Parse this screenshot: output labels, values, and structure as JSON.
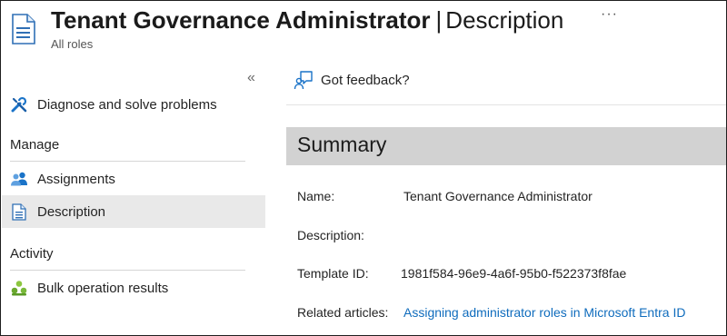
{
  "header": {
    "title_main": "Tenant Governance Administrator",
    "title_separator": "|",
    "title_section": "Description",
    "subtitle": "All roles",
    "more_label": "···"
  },
  "sidebar": {
    "collapse_label": "«",
    "items": {
      "diagnose": {
        "label": "Diagnose and solve problems",
        "icon": "wrench-screwdriver-icon"
      },
      "assignments": {
        "label": "Assignments",
        "icon": "users-icon"
      },
      "description": {
        "label": "Description",
        "icon": "document-icon",
        "selected": true
      },
      "bulk": {
        "label": "Bulk operation results",
        "icon": "bulk-operation-icon"
      }
    },
    "sections": {
      "manage": "Manage",
      "activity": "Activity"
    }
  },
  "main": {
    "feedback_label": "Got feedback?",
    "summary_title": "Summary",
    "properties": {
      "name_label": "Name:",
      "name_value": "Tenant Governance Administrator",
      "description_label": "Description:",
      "description_value": "",
      "template_label": "Template ID:",
      "template_value": "1981f584-96e9-4a6f-95b0-f522373f8fae",
      "related_label": "Related articles:",
      "related_value": "Assigning administrator roles in Microsoft Entra ID"
    }
  },
  "colors": {
    "link": "#0f6cbd",
    "selected_bg": "#e9e9e9",
    "summary_bg": "#d2d2d2",
    "icon_blue": "#1a73c8"
  }
}
